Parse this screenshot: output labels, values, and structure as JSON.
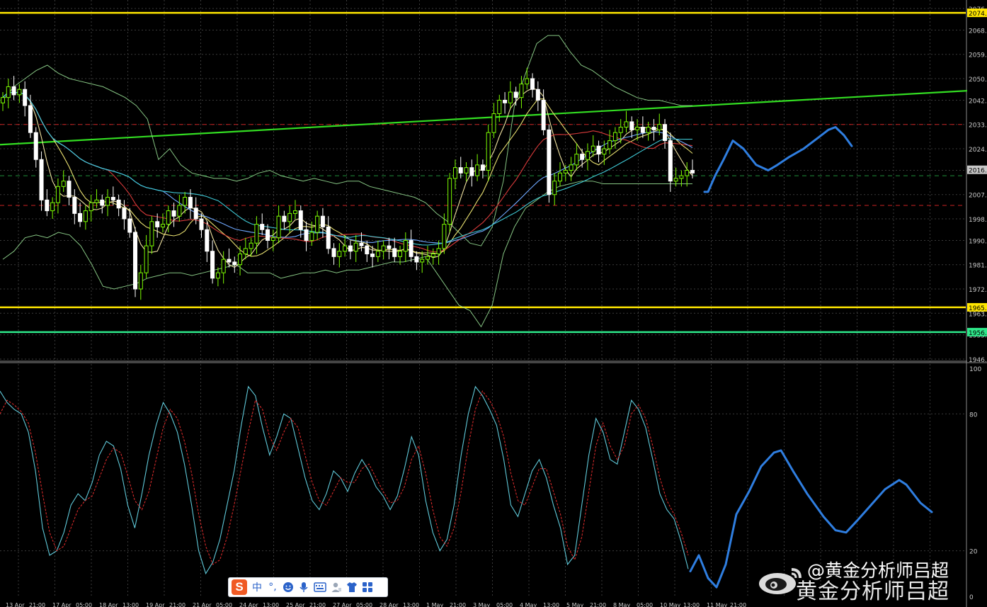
{
  "colors": {
    "background": "#000000",
    "grid": "#3a3a3a",
    "bull_candle": "#7CFC00",
    "bear_candle": "#ffffff",
    "yellow_level": "#ffe600",
    "green_level": "#2ee88a",
    "trendline": "#33dd22",
    "dashed_red": "#cc2222",
    "dashed_green": "#1f8f3a",
    "forecast": "#2f7ee0",
    "stoch_main": "#5fc8d8",
    "stoch_signal": "#d62a2a",
    "axis_text": "#c8c8c8"
  },
  "chart_data": [
    {
      "type": "candlestick",
      "panel": "price",
      "ylim": [
        1943,
        2079
      ],
      "y_ticks": [
        "2076.",
        "2068.",
        "2059.",
        "2050.",
        "2042.",
        "2033.",
        "2024.",
        "2016.",
        "2007.",
        "1998.",
        "1990.",
        "1981.",
        "1972.",
        "1963.",
        "1955.",
        "1946."
      ],
      "price_labels": [
        {
          "text": "2074.",
          "value": 2074.4,
          "color": "#ffe600"
        },
        {
          "text": "2016.",
          "value": 2016.2,
          "color": "#c8c8c8"
        },
        {
          "text": "1965.",
          "value": 1965.2,
          "color": "#ffe600"
        },
        {
          "text": "1956.",
          "value": 1956.0,
          "color": "#2ee88a"
        }
      ],
      "horizontal_levels": [
        {
          "value": 2074.4,
          "style": "solid",
          "color": "#ffe600"
        },
        {
          "value": 1965.2,
          "style": "solid",
          "color": "#ffe600"
        },
        {
          "value": 1956.0,
          "style": "solid",
          "color": "#2ee88a"
        },
        {
          "value": 2033.0,
          "style": "dashed",
          "color": "#cc2222"
        },
        {
          "value": 2003.0,
          "style": "dashed",
          "color": "#cc2222"
        },
        {
          "value": 2014.0,
          "style": "dashed",
          "color": "#1f8f3a"
        }
      ],
      "trendline": {
        "start": [
          0,
          2025.5
        ],
        "end": [
          1366,
          2045.5
        ]
      },
      "close": [
        2043,
        2047,
        2044,
        2046,
        2040,
        2030,
        2020,
        2005,
        2001,
        2004,
        2010,
        2012,
        2006,
        2000,
        1997,
        2001,
        2004,
        2005,
        2003,
        2006,
        2005,
        2002,
        1998,
        1993,
        1972,
        1978,
        1988,
        1997,
        1995,
        1996,
        2001,
        1999,
        2003,
        2006,
        2002,
        1998,
        1994,
        1986,
        1976,
        1978,
        1983,
        1982,
        1981,
        1985,
        1987,
        1989,
        1996,
        1994,
        1990,
        1991,
        1999,
        1997,
        2000,
        2001,
        1994,
        1990,
        1993,
        1999,
        1995,
        1987,
        1984,
        1986,
        1988,
        1986,
        1989,
        1988,
        1985,
        1984,
        1986,
        1988,
        1987,
        1984,
        1986,
        1990,
        1984,
        1982,
        1983,
        1984,
        1985,
        1987,
        1996,
        2013,
        2017,
        2015,
        2017,
        2014,
        2018,
        2016,
        2030,
        2037,
        2042,
        2041,
        2045,
        2043,
        2048,
        2050,
        2046,
        2042,
        2031,
        2007,
        2012,
        2015,
        2016,
        2018,
        2022,
        2020,
        2023,
        2025,
        2022,
        2024,
        2027,
        2030,
        2032,
        2034,
        2031,
        2032,
        2030,
        2032,
        2031,
        2033,
        2027,
        2012,
        2013,
        2014,
        2016,
        2015
      ],
      "bands": {
        "upper": [
          2042,
          2047,
          2050,
          2053,
          2055,
          2052,
          2050,
          2049,
          2048,
          2047,
          2045,
          2043,
          2040,
          2035,
          2020,
          2024,
          2018,
          2015,
          2014,
          2013,
          2013,
          2012,
          2013,
          2015,
          2016,
          2014,
          2013,
          2012,
          2013,
          2012,
          2011,
          2012,
          2012,
          2010,
          2009,
          2008,
          2007,
          2006,
          2004,
          2000,
          1997,
          1993,
          1989,
          1988,
          1995,
          2012,
          2040,
          2052,
          2063,
          2066,
          2066,
          2060,
          2055,
          2053,
          2050,
          2047,
          2045,
          2043,
          2042,
          2042,
          2041,
          2040,
          2040
        ],
        "lower": [
          1983,
          1986,
          1991,
          1992,
          1991,
          1993,
          1992,
          1988,
          1981,
          1973,
          1972,
          1973,
          1974,
          1976,
          1977,
          1978,
          1978,
          1977,
          1978,
          1979,
          1980,
          1981,
          1978,
          1978,
          1978,
          1976,
          1977,
          1978,
          1978,
          1979,
          1978,
          1979,
          1979,
          1980,
          1981,
          1982,
          1982,
          1983,
          1984,
          1978,
          1972,
          1966,
          1964,
          1958,
          1966,
          1985,
          1995,
          2002,
          2005,
          2008,
          2010,
          2011,
          2012,
          2012,
          2011,
          2011,
          2011,
          2011,
          2011,
          2011,
          2011,
          2011,
          2011
        ]
      }
    },
    {
      "type": "line",
      "panel": "stochastic",
      "ylim": [
        0,
        100
      ],
      "y_ticks": [
        "100",
        "80",
        "20",
        "0"
      ],
      "x_ticks": [
        "13 Apr",
        "21:00",
        "17 Apr",
        "05:00",
        "18 Apr",
        "13:00",
        "19 Apr",
        "21:00",
        "21 Apr",
        "05:00",
        "24 Apr",
        "13:00",
        "25 Apr",
        "21:00",
        "27 Apr",
        "05:00",
        "28 Apr",
        "13:00",
        "1 May",
        "21:00",
        "3 May",
        "05:00",
        "4 May",
        "13:00",
        "5 May",
        "21:00",
        "8 May",
        "05:00",
        "10 May",
        "13:00",
        "11 May",
        "21:00"
      ],
      "series": [
        {
          "role": "main",
          "values": [
            90,
            85,
            82,
            80,
            72,
            55,
            30,
            18,
            20,
            28,
            40,
            45,
            42,
            50,
            62,
            68,
            66,
            56,
            40,
            30,
            45,
            62,
            75,
            85,
            80,
            72,
            58,
            40,
            20,
            10,
            15,
            25,
            40,
            55,
            75,
            92,
            88,
            74,
            62,
            70,
            80,
            78,
            65,
            52,
            42,
            38,
            45,
            55,
            52,
            46,
            54,
            60,
            55,
            48,
            44,
            38,
            44,
            56,
            70,
            62,
            42,
            28,
            20,
            25,
            40,
            62,
            80,
            92,
            88,
            82,
            75,
            60,
            40,
            35,
            45,
            55,
            60,
            52,
            40,
            30,
            14,
            18,
            40,
            62,
            78,
            72,
            60,
            58,
            72,
            86,
            82,
            74,
            60,
            45,
            38,
            34,
            24,
            12
          ]
        },
        {
          "role": "signal",
          "values": [
            80,
            86,
            84,
            81,
            76,
            63,
            45,
            28,
            20,
            22,
            30,
            38,
            42,
            44,
            52,
            60,
            65,
            63,
            53,
            42,
            38,
            46,
            60,
            74,
            82,
            78,
            68,
            54,
            36,
            22,
            14,
            16,
            26,
            40,
            56,
            72,
            86,
            82,
            70,
            64,
            72,
            78,
            74,
            62,
            50,
            42,
            40,
            46,
            52,
            50,
            50,
            56,
            58,
            52,
            46,
            41,
            42,
            48,
            60,
            66,
            54,
            38,
            26,
            22,
            30,
            46,
            66,
            82,
            90,
            86,
            80,
            70,
            54,
            42,
            40,
            48,
            56,
            56,
            46,
            36,
            22,
            16,
            26,
            46,
            66,
            76,
            66,
            60,
            66,
            80,
            84,
            78,
            66,
            52,
            42,
            36,
            28,
            18
          ]
        }
      ]
    }
  ],
  "ime_toolbar": {
    "logo": "S",
    "lang": "中",
    "punct": "°,",
    "items": [
      "smiley-icon",
      "microphone-icon",
      "keyboard-icon",
      "user-icon",
      "shirt-icon",
      "grid-icon"
    ]
  },
  "watermark": {
    "line1": "@黄金分析师吕超",
    "line2": "黄金分析师吕超",
    "logo": "weibo-logo-icon"
  }
}
